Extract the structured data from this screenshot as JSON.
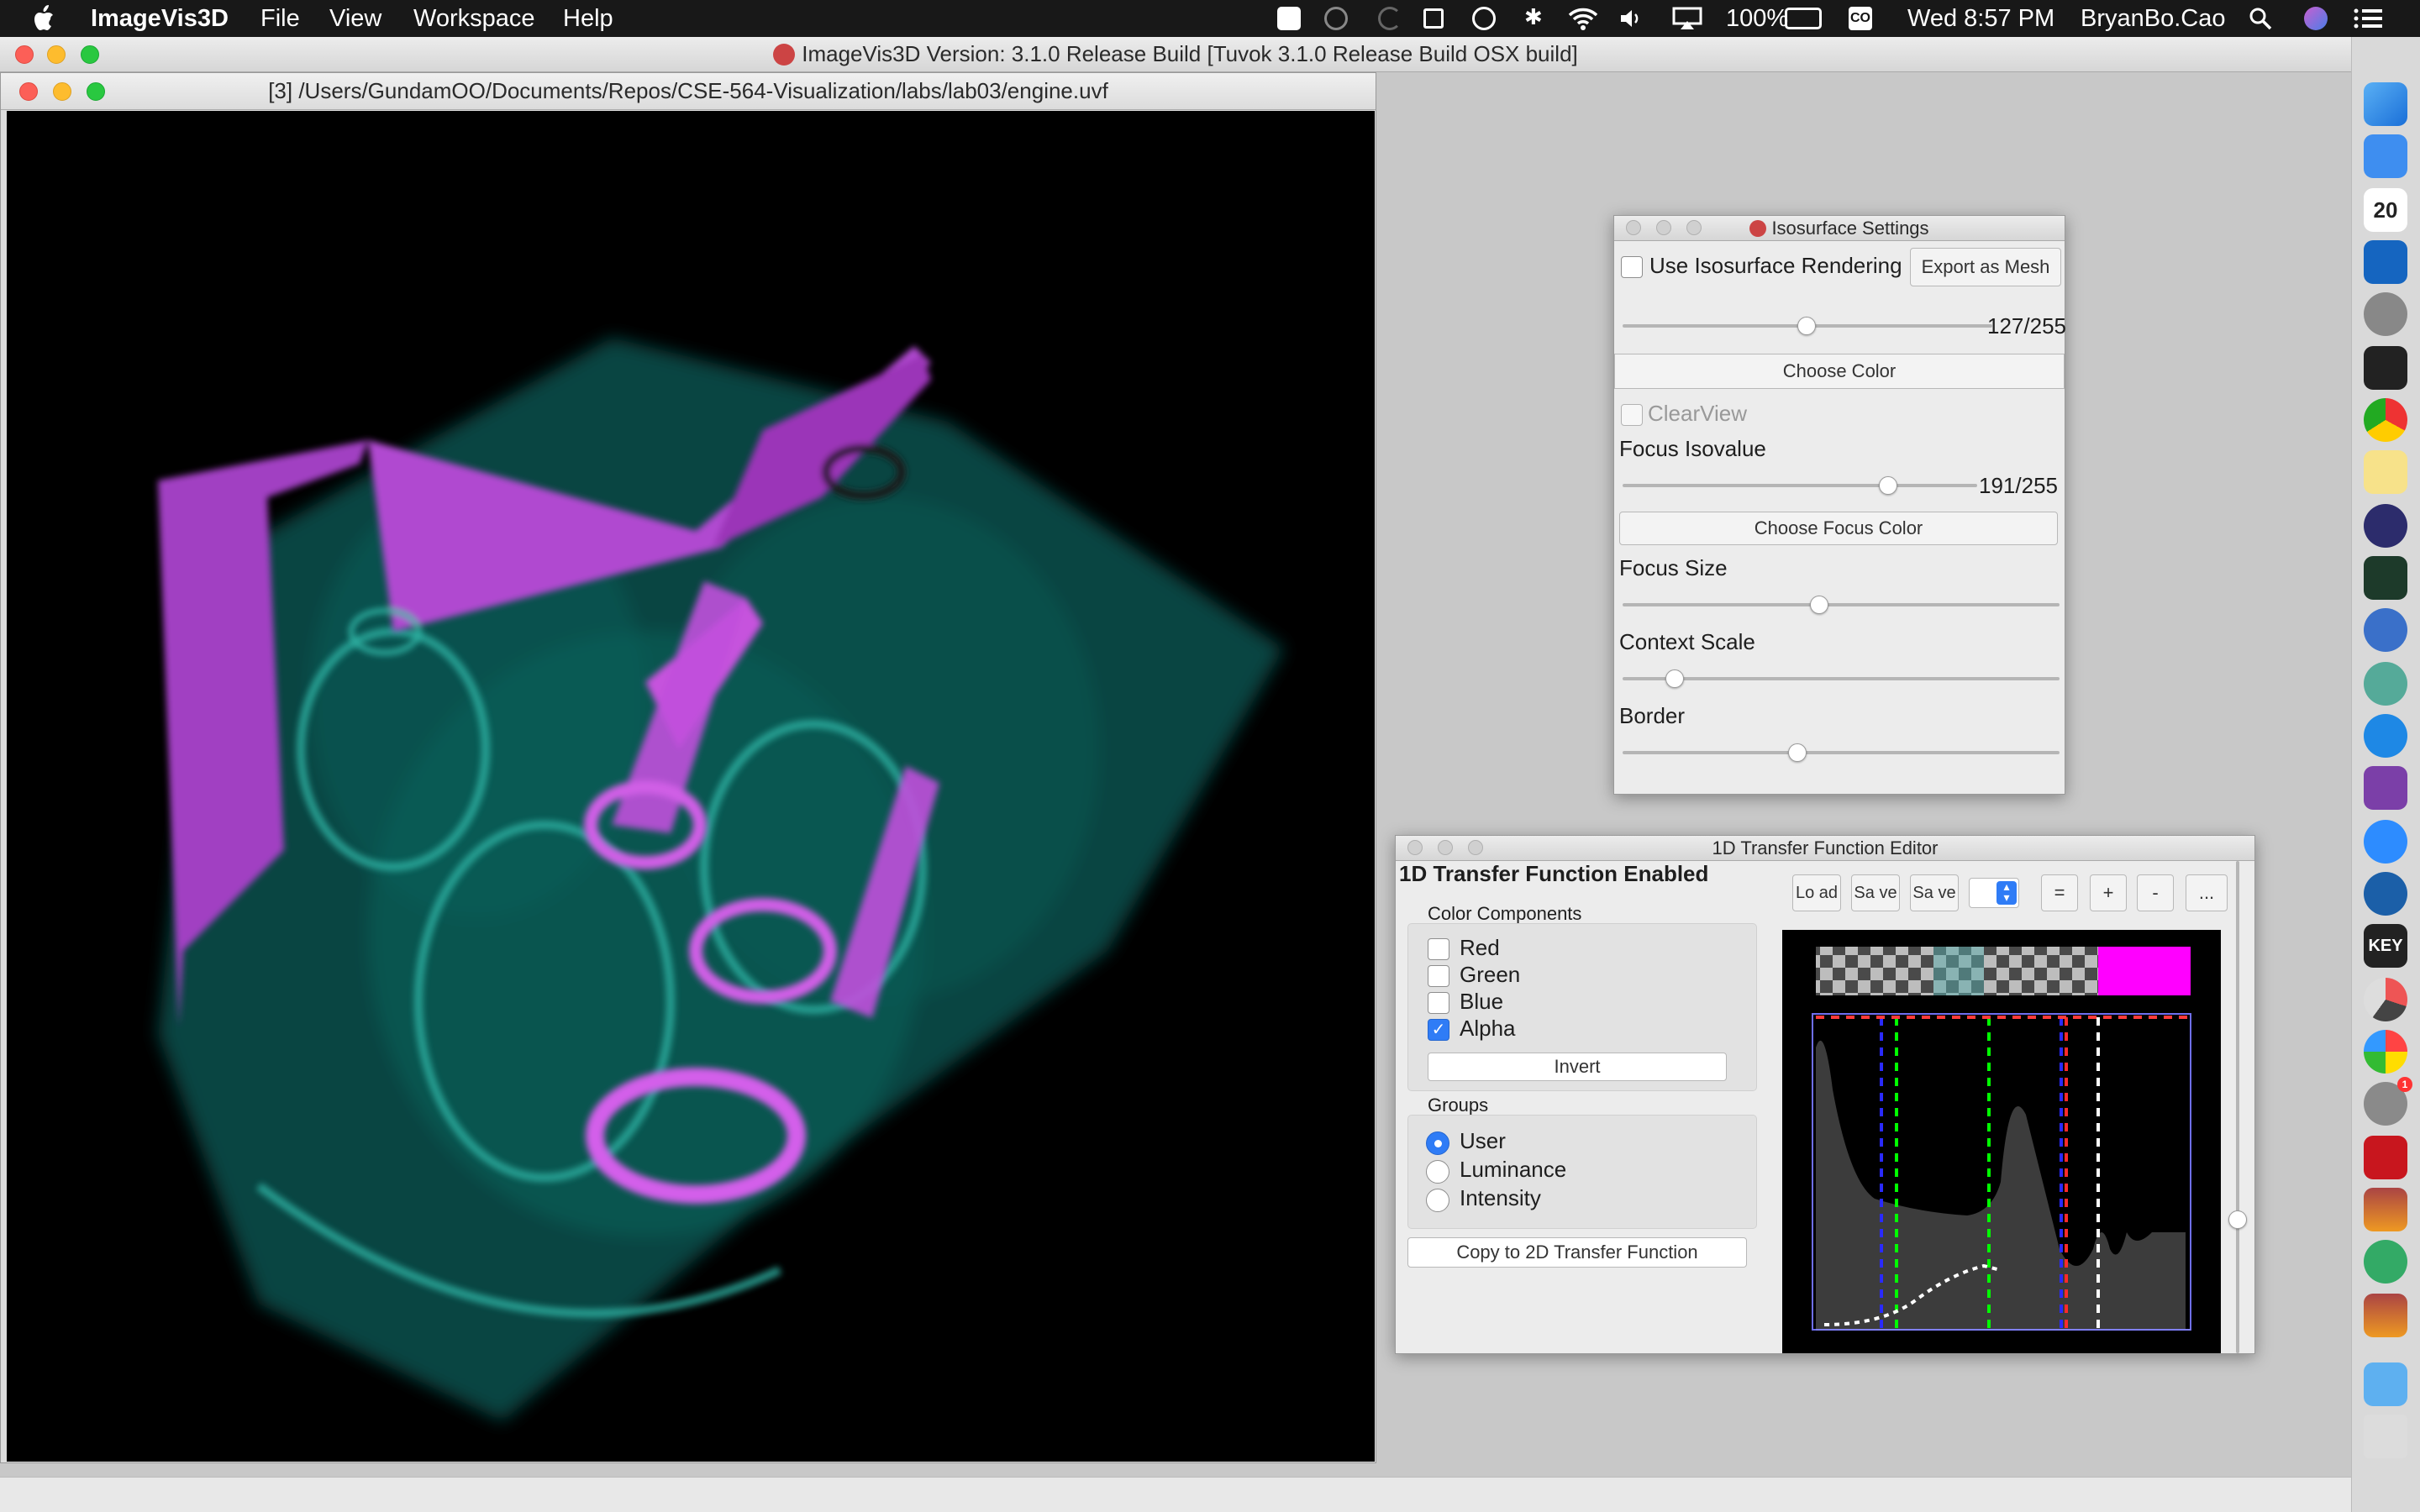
{
  "menubar": {
    "app_name": "ImageVis3D",
    "menus": [
      "File",
      "View",
      "Workspace",
      "Help"
    ],
    "battery": "100%",
    "clock": "Wed 8:57 PM",
    "user": "BryanBo.Cao",
    "input_source": "CO"
  },
  "main_window": {
    "title": "ImageVis3D Version: 3.1.0 Release Build [Tuvok 3.1.0 Release Build OSX build]"
  },
  "render_window": {
    "title": "[3] /Users/GundamOO/Documents/Repos/CSE-564-Visualization/labs/lab03/engine.uvf"
  },
  "iso_panel": {
    "title": "Isosurface Settings",
    "use_iso_label": "Use Isosurface Rendering",
    "use_iso_checked": false,
    "export_button": "Export as Mesh",
    "isovalue_readout": "127/255",
    "isovalue_fraction": 0.498,
    "choose_color_button": "Choose Color",
    "clearview_label": "ClearView",
    "clearview_checked": false,
    "focus_isovalue_label": "Focus Isovalue",
    "focus_isovalue_readout": "191/255",
    "focus_isovalue_fraction": 0.749,
    "choose_focus_color_button": "Choose Focus Color",
    "focus_size_label": "Focus Size",
    "focus_size_fraction": 0.45,
    "context_scale_label": "Context Scale",
    "context_scale_fraction": 0.12,
    "border_label": "Border",
    "border_fraction": 0.4
  },
  "tf_panel": {
    "title": "1D Transfer Function Editor",
    "status": "1D Transfer Function Enabled",
    "color_components_label": "Color Components",
    "components": [
      {
        "label": "Red",
        "checked": false
      },
      {
        "label": "Green",
        "checked": false
      },
      {
        "label": "Blue",
        "checked": false
      },
      {
        "label": "Alpha",
        "checked": true
      }
    ],
    "invert_button": "Invert",
    "groups_label": "Groups",
    "groups": [
      {
        "label": "User",
        "selected": true
      },
      {
        "label": "Luminance",
        "selected": false
      },
      {
        "label": "Intensity",
        "selected": false
      }
    ],
    "copy_button": "Copy to 2D Transfer Function",
    "toolbar": {
      "load": "Lo ad",
      "save1": "Sa ve",
      "save2": "Sa ve",
      "equals": "=",
      "plus": "+",
      "minus": "-",
      "more": "..."
    },
    "colors": {
      "magenta": "#ff00ff",
      "green_line": "#00ff00",
      "blue_line": "#0000ff",
      "red_line": "#ff0000"
    }
  },
  "dock": {
    "calendar_day": "20",
    "keynote_label": "KEY",
    "notification_badge": "1"
  }
}
